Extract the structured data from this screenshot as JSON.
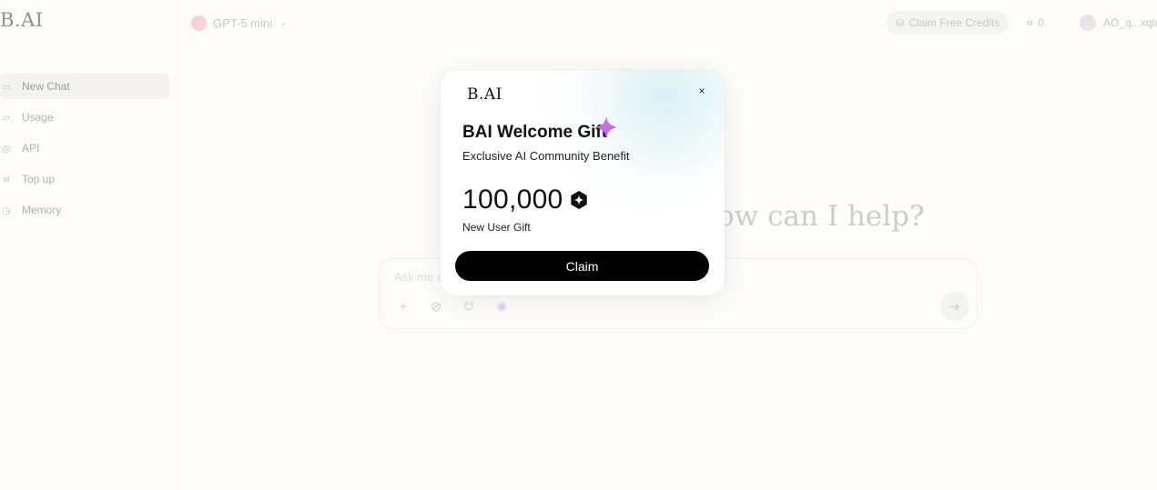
{
  "app": {
    "logo": "B.AI",
    "sidebar": {
      "items": [
        {
          "label": "New Chat",
          "icon": "chat-icon"
        },
        {
          "label": "Usage",
          "icon": "usage-icon"
        },
        {
          "label": "API",
          "icon": "api-icon"
        },
        {
          "label": "Top up",
          "icon": "topup-icon"
        },
        {
          "label": "Memory",
          "icon": "memory-icon"
        }
      ]
    },
    "header": {
      "model_name": "GPT-5 mini",
      "claim_credits_label": "Claim Free Credits",
      "credit_count": "0",
      "username": "AO_q...xqtu"
    },
    "main": {
      "headline": "ow can I help?",
      "composer_placeholder": "Ask me a"
    }
  },
  "modal": {
    "logo": "B.AI",
    "close_label": "×",
    "title": "BAI Welcome Gift",
    "subtitle": "Exclusive AI Community Benefit",
    "amount": "100,000",
    "gift_label": "New User Gift",
    "claim_label": "Claim"
  },
  "colors": {
    "background": "#fdfcf9",
    "button": "#000000",
    "sparkle": "#c86af5"
  }
}
